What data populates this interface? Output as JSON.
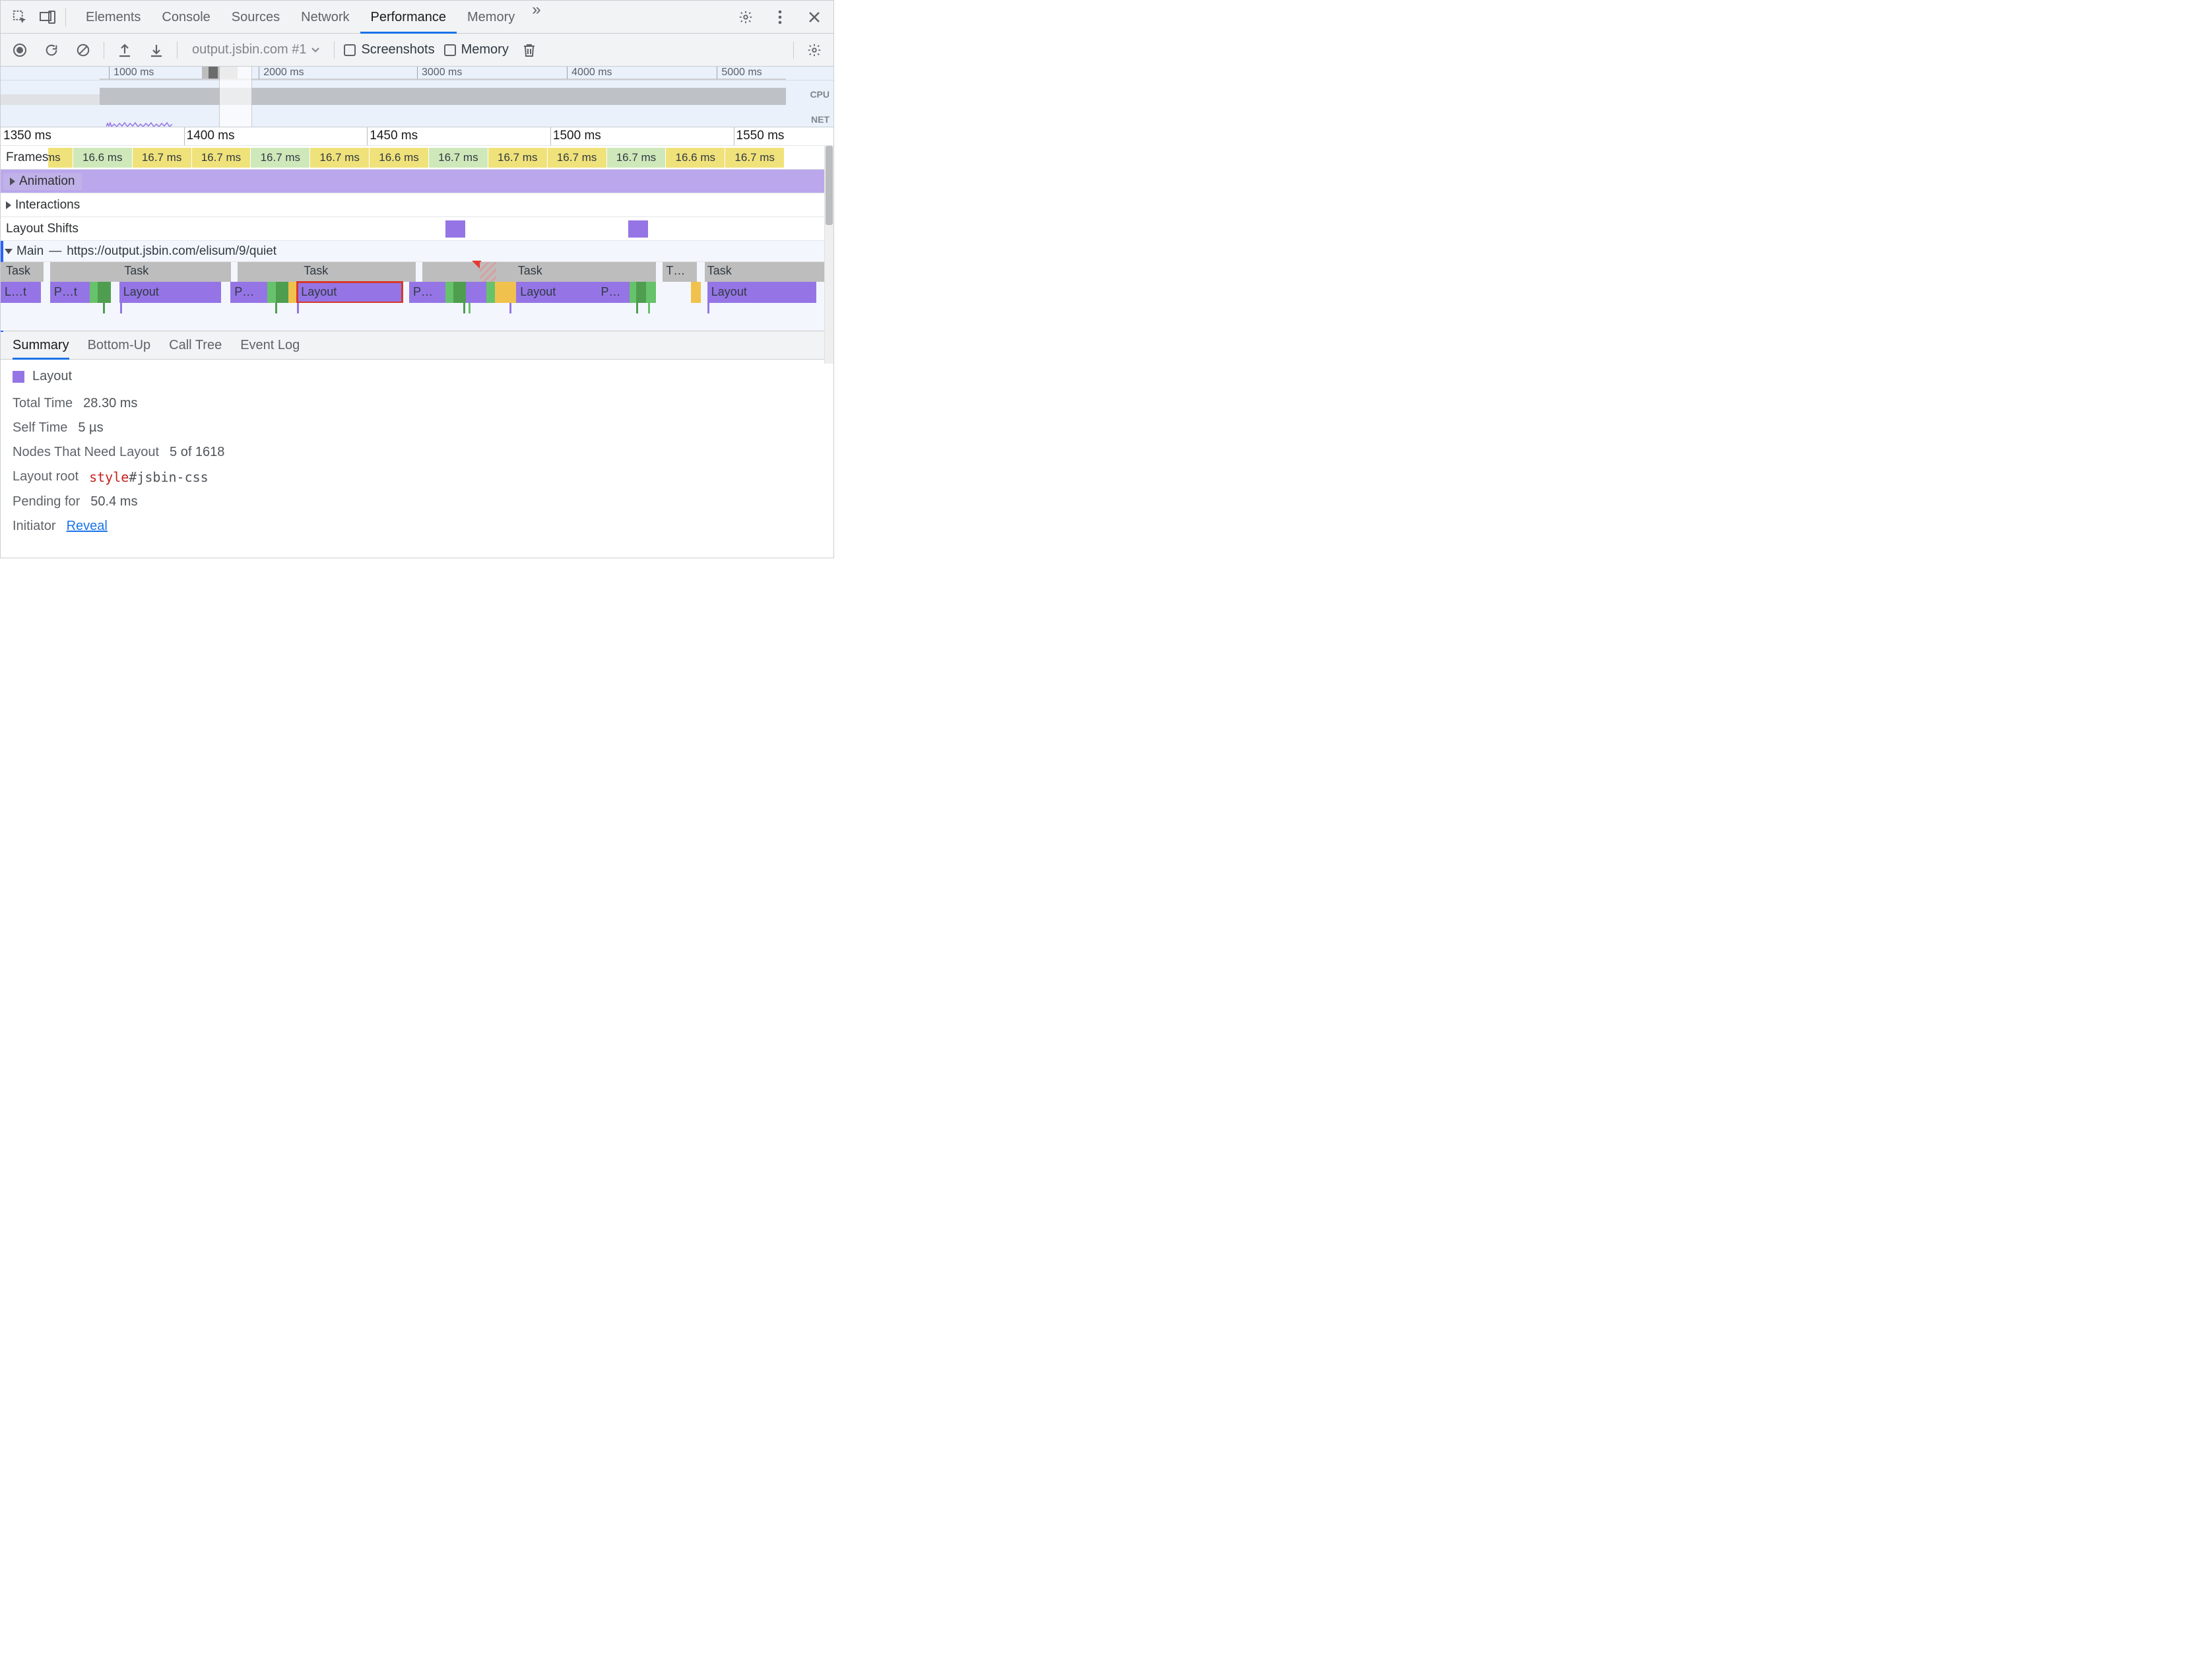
{
  "tabs": {
    "elements": "Elements",
    "console": "Console",
    "sources": "Sources",
    "network": "Network",
    "performance": "Performance",
    "memory": "Memory",
    "more": "»"
  },
  "activeTab": "performance",
  "actionbar": {
    "dropdown": "output.jsbin.com #1",
    "screenshots": "Screenshots",
    "memory": "Memory"
  },
  "overview": {
    "ticks": [
      "1000 ms",
      "2000 ms",
      "3000 ms",
      "4000 ms",
      "5000 ms"
    ],
    "cpuLabel": "CPU",
    "netLabel": "NET",
    "window": {
      "leftPct": 26.2,
      "widthPct": 4.0
    }
  },
  "ruler": {
    "ticks": [
      "1350 ms",
      "1400 ms",
      "1450 ms",
      "1500 ms",
      "1550 ms"
    ],
    "positionsPct": [
      0,
      22,
      44,
      66,
      88
    ]
  },
  "frames": {
    "label": "Frames",
    "cells": [
      {
        "w": 4.0,
        "txt": "",
        "warn": true
      },
      {
        "w": 4.8,
        "txt": "ms",
        "warn": true
      },
      {
        "w": 7.2,
        "txt": "16.6 ms",
        "warn": false
      },
      {
        "w": 7.2,
        "txt": "16.7 ms",
        "warn": true
      },
      {
        "w": 7.2,
        "txt": "16.7 ms",
        "warn": true
      },
      {
        "w": 7.2,
        "txt": "16.7 ms",
        "warn": false
      },
      {
        "w": 7.2,
        "txt": "16.7 ms",
        "warn": true
      },
      {
        "w": 7.2,
        "txt": "16.6 ms",
        "warn": true
      },
      {
        "w": 7.2,
        "txt": "16.7 ms",
        "warn": false
      },
      {
        "w": 7.2,
        "txt": "16.7 ms",
        "warn": true
      },
      {
        "w": 7.2,
        "txt": "16.7 ms",
        "warn": true
      },
      {
        "w": 7.2,
        "txt": "16.7 ms",
        "warn": false
      },
      {
        "w": 7.2,
        "txt": "16.6 ms",
        "warn": true
      },
      {
        "w": 7.2,
        "txt": "16.7 ms",
        "warn": true
      }
    ]
  },
  "animationLabel": "Animation",
  "interactionsLabel": "Interactions",
  "layoutShiftsLabel": "Layout Shifts",
  "layoutShifts": [
    {
      "leftPct": 54.0,
      "wPct": 2.4
    },
    {
      "leftPct": 76.2,
      "wPct": 2.4
    }
  ],
  "main": {
    "label": "Main",
    "sep": "—",
    "url": "https://output.jsbin.com/elisum/9/quiet"
  },
  "tasks": {
    "label": "Task",
    "gaps": [
      {
        "l": 5.2,
        "w": 0.8
      },
      {
        "l": 28.0,
        "w": 0.8
      },
      {
        "l": 50.4,
        "w": 0.8
      },
      {
        "l": 79.6,
        "w": 0.8
      },
      {
        "l": 84.5,
        "w": 1.0
      }
    ],
    "labels": [
      {
        "l": 15,
        "t": "Task"
      },
      {
        "l": 36.8,
        "t": "Task"
      },
      {
        "l": 62.8,
        "t": "Task"
      },
      {
        "l": 80.8,
        "t": "T…"
      },
      {
        "l": 85.8,
        "t": "Task"
      }
    ],
    "warnAt": 57.2
  },
  "work": [
    {
      "l": 0,
      "w": 4.9,
      "cls": "purple",
      "txt": "L…t"
    },
    {
      "l": 6.0,
      "w": 4.8,
      "cls": "purple",
      "txt": "P…t"
    },
    {
      "l": 10.8,
      "w": 1.0,
      "cls": "green",
      "txt": ""
    },
    {
      "l": 11.8,
      "w": 1.6,
      "cls": "dkgreen",
      "txt": ""
    },
    {
      "l": 14.4,
      "w": 12.4,
      "cls": "purple",
      "txt": "Layout"
    },
    {
      "l": 27.9,
      "w": 4.5,
      "cls": "purple",
      "txt": "P…"
    },
    {
      "l": 32.4,
      "w": 1.0,
      "cls": "green",
      "txt": ""
    },
    {
      "l": 33.4,
      "w": 1.5,
      "cls": "dkgreen",
      "txt": ""
    },
    {
      "l": 34.9,
      "w": 1.0,
      "cls": "yellow",
      "txt": ""
    },
    {
      "l": 36.0,
      "w": 12.8,
      "cls": "purple sel",
      "txt": "Layout"
    },
    {
      "l": 49.6,
      "w": 4.4,
      "cls": "purple",
      "txt": "P…"
    },
    {
      "l": 54.0,
      "w": 1.0,
      "cls": "green",
      "txt": ""
    },
    {
      "l": 55.0,
      "w": 1.5,
      "cls": "dkgreen",
      "txt": ""
    },
    {
      "l": 56.5,
      "w": 2.5,
      "cls": "purple",
      "txt": ""
    },
    {
      "l": 59.0,
      "w": 1.0,
      "cls": "green",
      "txt": ""
    },
    {
      "l": 60.0,
      "w": 2.6,
      "cls": "yellow",
      "txt": ""
    },
    {
      "l": 62.6,
      "w": 9.8,
      "cls": "purple",
      "txt": "Layout"
    },
    {
      "l": 72.4,
      "w": 4.0,
      "cls": "purple",
      "txt": "P…"
    },
    {
      "l": 76.4,
      "w": 0.8,
      "cls": "green",
      "txt": ""
    },
    {
      "l": 77.2,
      "w": 1.2,
      "cls": "dkgreen",
      "txt": ""
    },
    {
      "l": 78.4,
      "w": 1.2,
      "cls": "green",
      "txt": ""
    },
    {
      "l": 83.8,
      "w": 0.6,
      "cls": "yellow",
      "txt": ""
    },
    {
      "l": 84.4,
      "w": 0.6,
      "cls": "yellow",
      "txt": ""
    },
    {
      "l": 85.8,
      "w": 13.2,
      "cls": "purple",
      "txt": "Layout"
    }
  ],
  "tiny": [
    {
      "l": 12.4,
      "cls": "dkgreen"
    },
    {
      "l": 14.5,
      "cls": "purple"
    },
    {
      "l": 33.3,
      "cls": "dkgreen"
    },
    {
      "l": 36.0,
      "cls": "purple"
    },
    {
      "l": 56.2,
      "cls": "dkgreen"
    },
    {
      "l": 56.8,
      "cls": "green"
    },
    {
      "l": 61.8,
      "cls": "purple"
    },
    {
      "l": 77.2,
      "cls": "dkgreen"
    },
    {
      "l": 78.6,
      "cls": "green"
    },
    {
      "l": 85.8,
      "cls": "purple"
    }
  ],
  "detailTabs": {
    "summary": "Summary",
    "bottomUp": "Bottom-Up",
    "callTree": "Call Tree",
    "eventLog": "Event Log"
  },
  "summary": {
    "title": "Layout",
    "totalTime": {
      "k": "Total Time",
      "v": "28.30 ms"
    },
    "selfTime": {
      "k": "Self Time",
      "v": "5 µs"
    },
    "nodes": {
      "k": "Nodes That Need Layout",
      "v": "5 of 1618"
    },
    "layoutRoot": {
      "k": "Layout root",
      "tag": "style",
      "sel": "#jsbin-css"
    },
    "pending": {
      "k": "Pending for",
      "v": "50.4 ms"
    },
    "initiator": {
      "k": "Initiator",
      "link": "Reveal"
    }
  }
}
